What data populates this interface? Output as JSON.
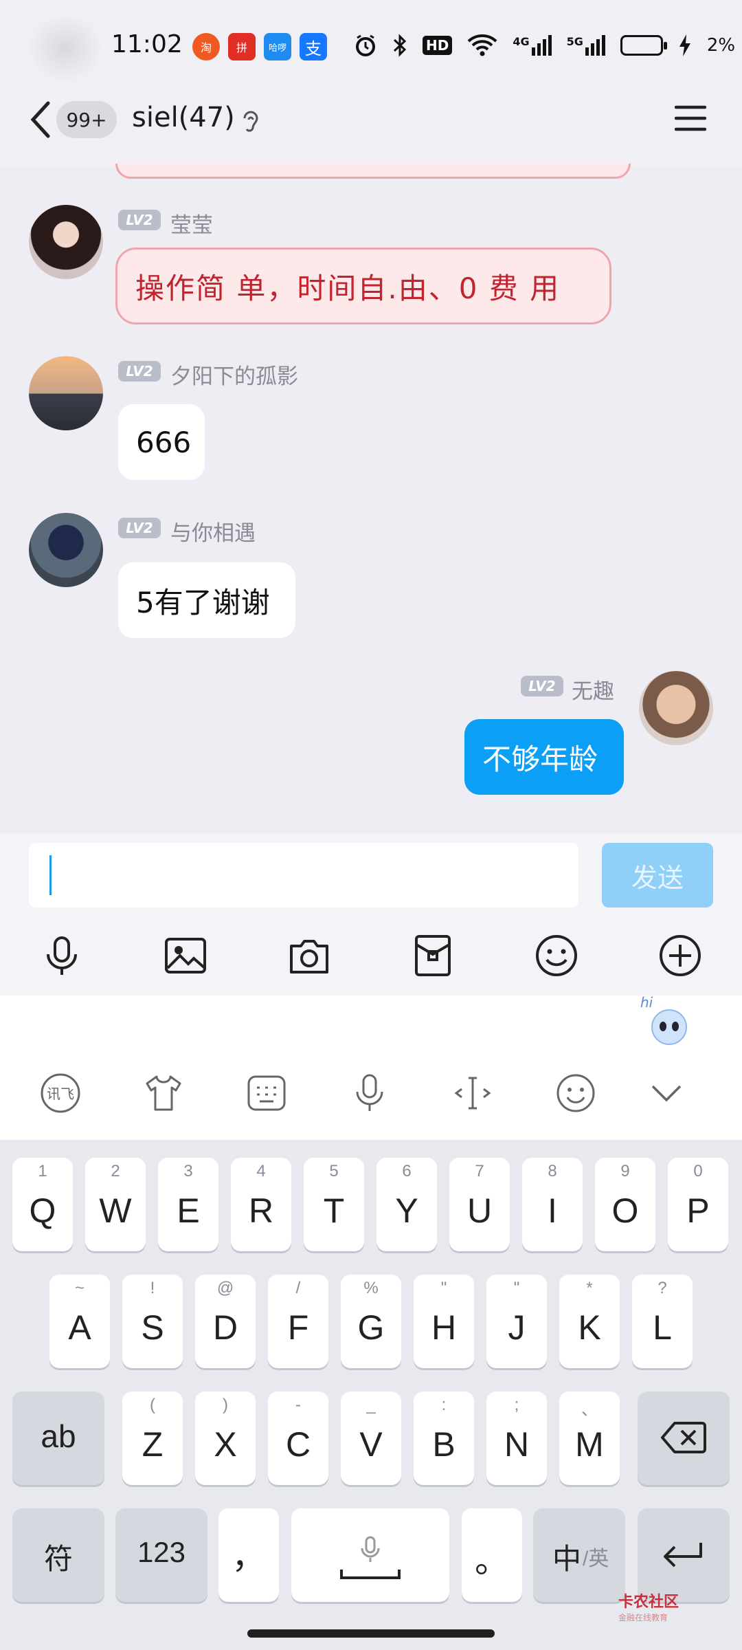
{
  "status_bar": {
    "time": "11:02",
    "app_icons": [
      "taobao-icon",
      "pinduoduo-icon",
      "hello-icon",
      "alipay-icon"
    ],
    "system_icons": [
      "alarm-icon",
      "bluetooth-icon",
      "hd-icon",
      "wifi-icon",
      "4g-signal-icon",
      "5g-signal-icon"
    ],
    "network_4g": "4G",
    "network_5g": "5G",
    "hd": "HD",
    "battery_percent": "2%"
  },
  "header": {
    "unread_badge": "99+",
    "title": "siel(47)"
  },
  "messages": [
    {
      "sender": "莹莹",
      "level": "LV2",
      "text": "操作简 单，时间自.由、0  费 用",
      "style": "fancy"
    },
    {
      "sender": "夕阳下的孤影",
      "level": "LV2",
      "text": "666",
      "style": "normal"
    },
    {
      "sender": "与你相遇",
      "level": "LV2",
      "text": "5有了谢谢",
      "style": "normal"
    },
    {
      "sender": "无趣",
      "level": "LV2",
      "text": "不够年龄",
      "style": "mine"
    }
  ],
  "composer": {
    "input_value": "",
    "send_label": "发送",
    "tools": [
      "microphone-icon",
      "image-icon",
      "camera-icon",
      "red-packet-icon",
      "emoji-icon",
      "plus-icon"
    ]
  },
  "keyboard": {
    "mascot_text": "hi",
    "toolbar": [
      "voice-input-icon",
      "skin-icon",
      "keyboard-icon",
      "mic-icon",
      "cursor-icon",
      "emoji-icon",
      "collapse-icon"
    ],
    "row1": [
      {
        "main": "Q",
        "sub": "1"
      },
      {
        "main": "W",
        "sub": "2"
      },
      {
        "main": "E",
        "sub": "3"
      },
      {
        "main": "R",
        "sub": "4"
      },
      {
        "main": "T",
        "sub": "5"
      },
      {
        "main": "Y",
        "sub": "6"
      },
      {
        "main": "U",
        "sub": "7"
      },
      {
        "main": "I",
        "sub": "8"
      },
      {
        "main": "O",
        "sub": "9"
      },
      {
        "main": "P",
        "sub": "0"
      }
    ],
    "row2": [
      {
        "main": "A",
        "sub": "~"
      },
      {
        "main": "S",
        "sub": "!"
      },
      {
        "main": "D",
        "sub": "@"
      },
      {
        "main": "F",
        "sub": "/"
      },
      {
        "main": "G",
        "sub": "%"
      },
      {
        "main": "H",
        "sub": "\""
      },
      {
        "main": "J",
        "sub": "\""
      },
      {
        "main": "K",
        "sub": "*"
      },
      {
        "main": "L",
        "sub": "?"
      }
    ],
    "row3": [
      {
        "main": "Z",
        "sub": "("
      },
      {
        "main": "X",
        "sub": ")"
      },
      {
        "main": "C",
        "sub": "-"
      },
      {
        "main": "V",
        "sub": "_"
      },
      {
        "main": "B",
        "sub": ":"
      },
      {
        "main": "N",
        "sub": ";"
      },
      {
        "main": "M",
        "sub": "、"
      }
    ],
    "ab_label": "ab",
    "symbol_label": "符",
    "num_label": "123",
    "comma_label": "，",
    "period_label": "。",
    "lang_main": "中",
    "lang_sub": "/英"
  },
  "watermark": {
    "title": "卡农社区",
    "subtitle": "金融在线教育"
  }
}
